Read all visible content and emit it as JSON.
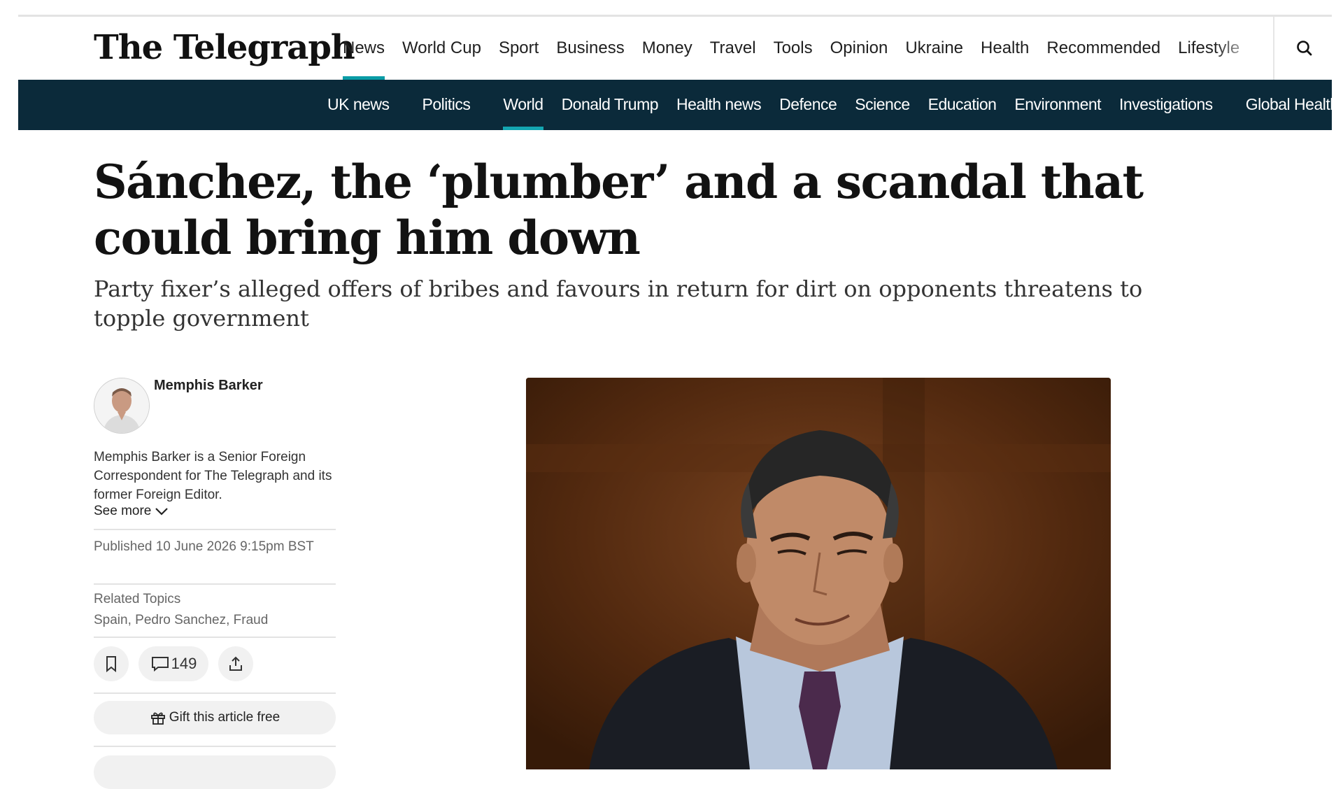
{
  "header": {
    "logo": "The Telegraph",
    "nav": [
      {
        "label": "News",
        "active": true
      },
      {
        "label": "World Cup"
      },
      {
        "label": "Sport"
      },
      {
        "label": "Business"
      },
      {
        "label": "Money"
      },
      {
        "label": "Travel"
      },
      {
        "label": "Tools"
      },
      {
        "label": "Opinion"
      },
      {
        "label": "Ukraine"
      },
      {
        "label": "Health"
      },
      {
        "label": "Recommended"
      },
      {
        "label": "Lifestyle"
      }
    ],
    "search_icon": "search-icon"
  },
  "subnav": [
    {
      "label": "UK news"
    },
    {
      "label": "Politics"
    },
    {
      "label": "World",
      "active": true
    },
    {
      "label": "Donald Trump"
    },
    {
      "label": "Health news"
    },
    {
      "label": "Defence"
    },
    {
      "label": "Science"
    },
    {
      "label": "Education"
    },
    {
      "label": "Environment"
    },
    {
      "label": "Investigations"
    },
    {
      "label": "Global Health"
    }
  ],
  "article": {
    "headline": "Sánchez, the ‘plumber’ and a scandal that could bring him down",
    "standfirst": "Party fixer’s alleged offers of bribes and favours in return for dirt on opponents threatens to topple government",
    "author": {
      "name": "Memphis Barker",
      "bio": "Memphis Barker is a Senior Foreign Correspondent for The Telegraph and its former Foreign Editor.",
      "see_more": "See more"
    },
    "published": "Published 10 June 2026 9:15pm BST",
    "related_topics_label": "Related Topics",
    "related_topics": "Spain, Pedro Sanchez, Fraud",
    "comment_count": "149",
    "gift_label": "Gift this article free"
  },
  "colors": {
    "accent": "#0a9ca6",
    "subnav_bg": "#0b2a3a"
  }
}
